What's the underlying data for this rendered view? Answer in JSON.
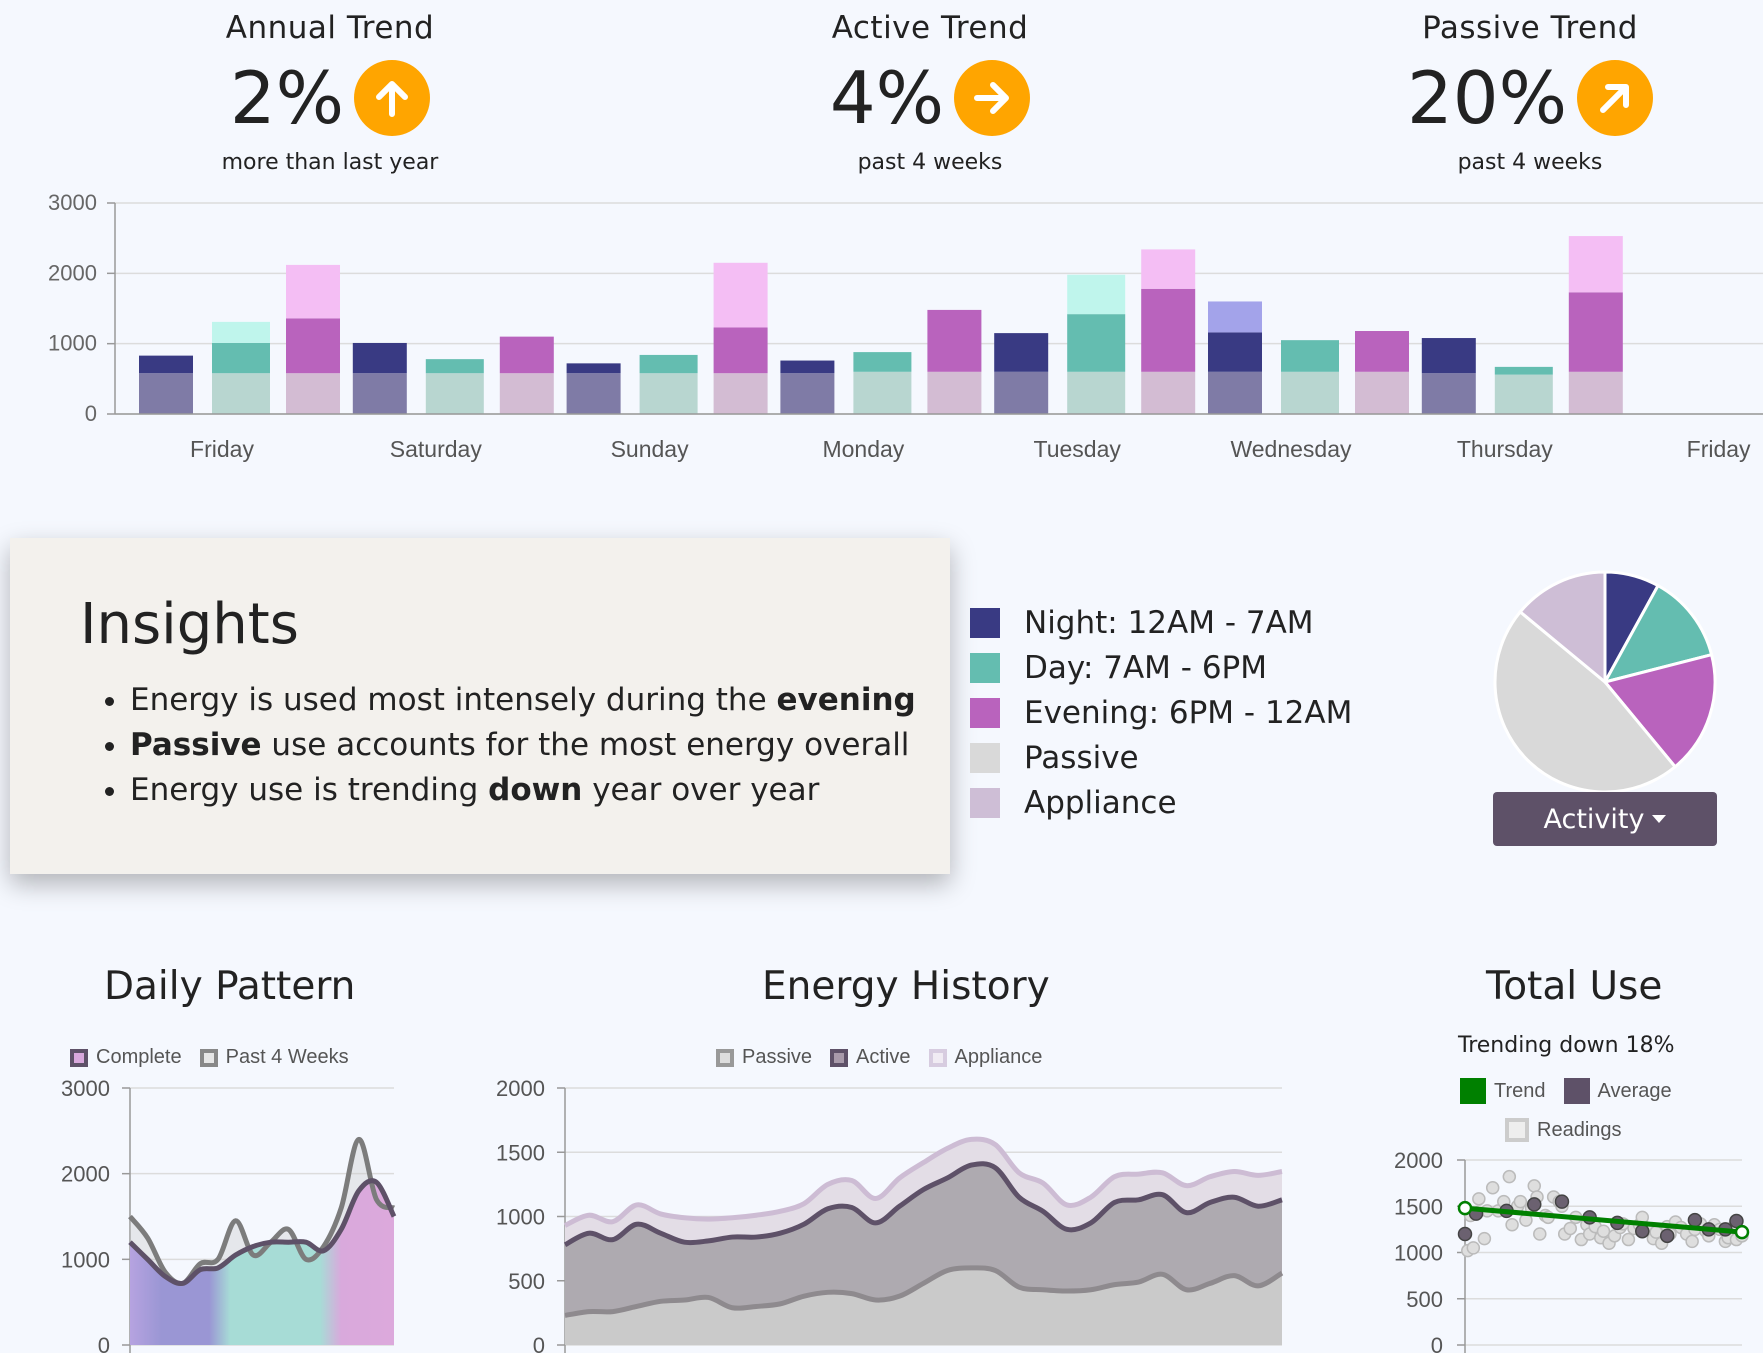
{
  "kpis": [
    {
      "title": "Annual Trend",
      "value": "2%",
      "subtitle": "more than last year",
      "icon": "arrow-up-icon"
    },
    {
      "title": "Active Trend",
      "value": "4%",
      "subtitle": "past 4 weeks",
      "icon": "arrow-right-icon"
    },
    {
      "title": "Passive Trend",
      "value": "20%",
      "subtitle": "past 4 weeks",
      "icon": "arrow-up-right-icon"
    }
  ],
  "colors": {
    "night": "#393a83",
    "day": "#64bdb0",
    "evening": "#b963bd",
    "passive": "#d9d9d9",
    "appliance": "#cebed6",
    "accent": "#ffa500",
    "button": "#5e5168",
    "trend": "#008000"
  },
  "insights": {
    "title": "Insights",
    "items": [
      {
        "pre": "Energy is used most intensely during the ",
        "bold": "evening",
        "post": ""
      },
      {
        "pre": "",
        "bold": "Passive",
        "post": " use accounts for the most energy overall"
      },
      {
        "pre": "Energy use is trending ",
        "bold": "down",
        "post": " year over year"
      }
    ]
  },
  "legend": [
    {
      "label": "Night: 12AM - 7AM",
      "color": "#393a83"
    },
    {
      "label": "Day: 7AM - 6PM",
      "color": "#64bdb0"
    },
    {
      "label": "Evening: 6PM - 12AM",
      "color": "#b963bd"
    },
    {
      "label": "Passive",
      "color": "#d9d9d9"
    },
    {
      "label": "Appliance",
      "color": "#cebed6"
    }
  ],
  "activity_button": {
    "label": "Activity"
  },
  "sections": {
    "daily": "Daily Pattern",
    "history": "Energy History",
    "total": "Total Use",
    "total_subtitle": "Trending down 18%"
  },
  "chart_data": [
    {
      "type": "bar",
      "id": "daily-stacked",
      "categories": [
        "Friday",
        "Saturday",
        "Sunday",
        "Monday",
        "Tuesday",
        "Wednesday",
        "Thursday",
        "Friday"
      ],
      "ylim": [
        0,
        3000
      ],
      "yticks": [
        0,
        1000,
        2000,
        3000
      ],
      "bars": [
        {
          "period": "night",
          "base": 580,
          "value": 250
        },
        {
          "period": "day",
          "base": 580,
          "value": 430,
          "extra": 300
        },
        {
          "period": "evening",
          "base": 580,
          "value": 780,
          "extra": 760
        },
        {
          "period": "night",
          "base": 580,
          "value": 430
        },
        {
          "period": "day",
          "base": 580,
          "value": 200
        },
        {
          "period": "evening",
          "base": 580,
          "value": 520
        },
        {
          "period": "night",
          "base": 580,
          "value": 140
        },
        {
          "period": "day",
          "base": 580,
          "value": 260
        },
        {
          "period": "evening",
          "base": 580,
          "value": 650,
          "extra": 920
        },
        {
          "period": "night",
          "base": 580,
          "value": 180
        },
        {
          "period": "day",
          "base": 600,
          "value": 280
        },
        {
          "period": "evening",
          "base": 600,
          "value": 880
        },
        {
          "period": "night",
          "base": 600,
          "value": 550
        },
        {
          "period": "day",
          "base": 600,
          "value": 820,
          "extra": 560
        },
        {
          "period": "evening",
          "base": 600,
          "value": 1180,
          "extra": 560
        },
        {
          "period": "night",
          "base": 600,
          "value": 560,
          "extra": 440
        },
        {
          "period": "day",
          "base": 600,
          "value": 450
        },
        {
          "period": "evening",
          "base": 600,
          "value": 580
        },
        {
          "period": "night",
          "base": 580,
          "value": 500
        },
        {
          "period": "day",
          "base": 560,
          "value": 110
        },
        {
          "period": "evening",
          "base": 600,
          "value": 1130,
          "extra": 800
        }
      ]
    },
    {
      "type": "pie",
      "id": "activity-pie",
      "slices": [
        {
          "name": "Night",
          "value": 8
        },
        {
          "name": "Day",
          "value": 13
        },
        {
          "name": "Evening",
          "value": 18
        },
        {
          "name": "Passive",
          "value": 47
        },
        {
          "name": "Appliance",
          "value": 14
        }
      ]
    },
    {
      "type": "area",
      "id": "daily-pattern",
      "title": "Daily Pattern",
      "ylim": [
        0,
        3000
      ],
      "yticks": [
        0,
        1000,
        2000,
        3000
      ],
      "series": [
        {
          "name": "Complete",
          "values": [
            1200,
            1000,
            800,
            720,
            880,
            900,
            1050,
            1150,
            1200,
            1200,
            1200,
            1100,
            1350,
            1800,
            1900,
            1500
          ]
        },
        {
          "name": "Past 4 Weeks",
          "values": [
            1500,
            1250,
            850,
            720,
            950,
            1000,
            1450,
            1050,
            1200,
            1350,
            1000,
            1150,
            1600,
            2400,
            1700,
            1600
          ]
        }
      ]
    },
    {
      "type": "area",
      "id": "energy-history",
      "title": "Energy History",
      "ylim": [
        0,
        2000
      ],
      "yticks": [
        0,
        500,
        1000,
        1500,
        2000
      ],
      "series": [
        {
          "name": "Passive",
          "values": [
            230,
            260,
            260,
            300,
            340,
            350,
            370,
            290,
            300,
            320,
            380,
            410,
            400,
            350,
            380,
            480,
            580,
            600,
            580,
            450,
            430,
            420,
            430,
            470,
            490,
            550,
            430,
            480,
            540,
            460,
            560
          ]
        },
        {
          "name": "Active",
          "values": [
            780,
            870,
            820,
            940,
            870,
            800,
            810,
            840,
            840,
            870,
            940,
            1060,
            1070,
            950,
            1080,
            1210,
            1300,
            1400,
            1380,
            1150,
            1040,
            900,
            950,
            1110,
            1130,
            1170,
            1030,
            1110,
            1150,
            1080,
            1130
          ]
        },
        {
          "name": "Appliance",
          "values": [
            930,
            1010,
            960,
            1090,
            1020,
            990,
            980,
            990,
            1010,
            1040,
            1100,
            1250,
            1280,
            1140,
            1300,
            1420,
            1530,
            1600,
            1560,
            1340,
            1260,
            1090,
            1150,
            1310,
            1330,
            1340,
            1240,
            1310,
            1350,
            1320,
            1350
          ]
        }
      ]
    },
    {
      "type": "scatter",
      "id": "total-use",
      "title": "Total Use",
      "subtitle": "Trending down 18%",
      "ylim": [
        0,
        2000
      ],
      "yticks": [
        0,
        500,
        1000,
        1500,
        2000
      ],
      "trend": [
        1480,
        1220
      ],
      "readings": [
        [
          0.0,
          1200
        ],
        [
          0.01,
          1020
        ],
        [
          0.02,
          1400
        ],
        [
          0.03,
          1050
        ],
        [
          0.05,
          1580
        ],
        [
          0.07,
          1150
        ],
        [
          0.08,
          1450
        ],
        [
          0.1,
          1700
        ],
        [
          0.12,
          1450
        ],
        [
          0.14,
          1550
        ],
        [
          0.16,
          1820
        ],
        [
          0.17,
          1300
        ],
        [
          0.19,
          1500
        ],
        [
          0.2,
          1550
        ],
        [
          0.22,
          1350
        ],
        [
          0.24,
          1480
        ],
        [
          0.25,
          1720
        ],
        [
          0.26,
          1600
        ],
        [
          0.27,
          1200
        ],
        [
          0.29,
          1400
        ],
        [
          0.3,
          1380
        ],
        [
          0.32,
          1600
        ],
        [
          0.34,
          1550
        ],
        [
          0.35,
          1500
        ],
        [
          0.36,
          1200
        ],
        [
          0.38,
          1260
        ],
        [
          0.4,
          1380
        ],
        [
          0.42,
          1140
        ],
        [
          0.44,
          1300
        ],
        [
          0.45,
          1200
        ],
        [
          0.47,
          1280
        ],
        [
          0.49,
          1160
        ],
        [
          0.5,
          1230
        ],
        [
          0.52,
          1100
        ],
        [
          0.54,
          1180
        ],
        [
          0.56,
          1270
        ],
        [
          0.57,
          1310
        ],
        [
          0.59,
          1140
        ],
        [
          0.61,
          1260
        ],
        [
          0.63,
          1300
        ],
        [
          0.64,
          1380
        ],
        [
          0.66,
          1250
        ],
        [
          0.68,
          1150
        ],
        [
          0.69,
          1220
        ],
        [
          0.71,
          1100
        ],
        [
          0.73,
          1280
        ],
        [
          0.74,
          1200
        ],
        [
          0.76,
          1330
        ],
        [
          0.78,
          1270
        ],
        [
          0.8,
          1200
        ],
        [
          0.82,
          1120
        ],
        [
          0.83,
          1250
        ],
        [
          0.85,
          1310
        ],
        [
          0.87,
          1230
        ],
        [
          0.88,
          1180
        ],
        [
          0.9,
          1300
        ],
        [
          0.92,
          1250
        ],
        [
          0.94,
          1120
        ],
        [
          0.95,
          1160
        ],
        [
          0.97,
          1280
        ],
        [
          0.98,
          1140
        ],
        [
          1.0,
          1180
        ]
      ],
      "averages": [
        [
          0.0,
          1200
        ],
        [
          0.04,
          1420
        ],
        [
          0.15,
          1450
        ],
        [
          0.25,
          1520
        ],
        [
          0.35,
          1550
        ],
        [
          0.45,
          1380
        ],
        [
          0.55,
          1320
        ],
        [
          0.64,
          1230
        ],
        [
          0.73,
          1180
        ],
        [
          0.83,
          1350
        ],
        [
          0.88,
          1250
        ],
        [
          0.94,
          1250
        ],
        [
          0.98,
          1340
        ]
      ]
    }
  ],
  "legends": {
    "daily": [
      {
        "label": "Complete",
        "color": "#b18fc0"
      },
      {
        "label": "Past 4 Weeks",
        "color": "#888888"
      }
    ],
    "history": [
      {
        "label": "Passive",
        "color": "#999999"
      },
      {
        "label": "Active",
        "color": "#5e5168"
      },
      {
        "label": "Appliance",
        "color": "#d7cce0"
      }
    ],
    "total": [
      {
        "label": "Trend",
        "color": "#008000"
      },
      {
        "label": "Average",
        "color": "#5e5168"
      }
    ],
    "total2": [
      {
        "label": "Readings",
        "color": "#cccccc"
      }
    ]
  }
}
